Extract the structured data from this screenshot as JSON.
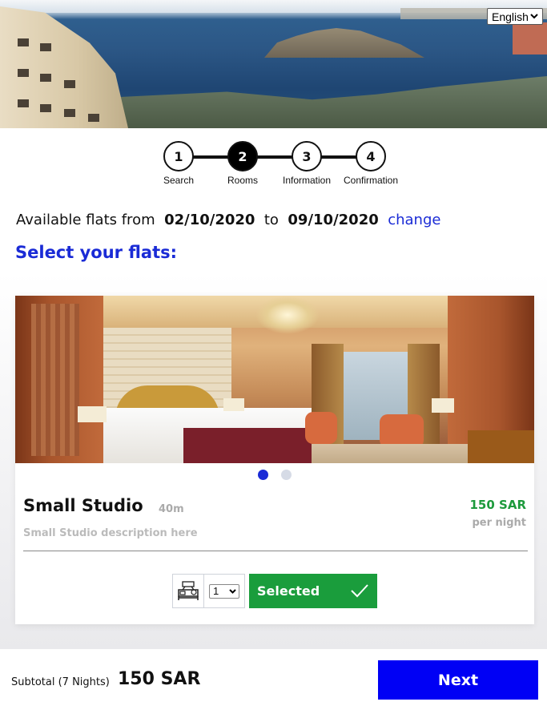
{
  "language": {
    "selected": "English"
  },
  "stepper": {
    "steps": [
      {
        "number": "1",
        "label": "Search"
      },
      {
        "number": "2",
        "label": "Rooms"
      },
      {
        "number": "3",
        "label": "Information"
      },
      {
        "number": "4",
        "label": "Confirmation"
      }
    ],
    "active_step": "2"
  },
  "availability": {
    "prefix": "Available flats from",
    "from_date": "02/10/2020",
    "to_word": "to",
    "to_date": "09/10/2020",
    "change_link": "change"
  },
  "select_title": "Select your flats:",
  "room": {
    "name": "Small Studio",
    "size": "40m",
    "description": "Small Studio description here",
    "price": "150 SAR",
    "price_unit": "per night",
    "carousel_total": 2,
    "carousel_active": 1,
    "quantity": "1",
    "selected_label": "Selected"
  },
  "footer": {
    "subtotal_label": "Subtotal (7 Nights)",
    "subtotal_value": "150 SAR",
    "next_label": "Next"
  },
  "colors": {
    "brand_blue": "#1a2bd6",
    "next_blue": "#0000f5",
    "selected_green": "#1a9d3c",
    "price_green": "#1d9a3c"
  },
  "icons": [
    "bed-icon",
    "check-icon",
    "chevron-down-icon"
  ]
}
